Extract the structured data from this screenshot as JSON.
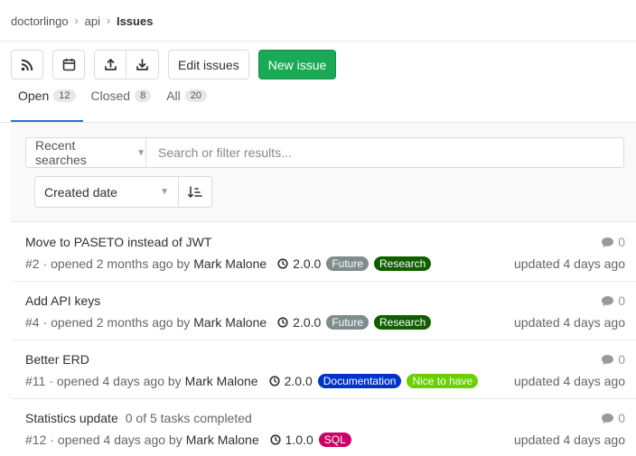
{
  "breadcrumb": {
    "group": "doctorlingo",
    "project": "api",
    "current": "Issues"
  },
  "toolbar": {
    "edit_label": "Edit issues",
    "new_label": "New issue"
  },
  "tabs": [
    {
      "label": "Open",
      "count": "12"
    },
    {
      "label": "Closed",
      "count": "8"
    },
    {
      "label": "All",
      "count": "20"
    }
  ],
  "filter": {
    "recent_label": "Recent searches",
    "search_placeholder": "Search or filter results...",
    "sort_label": "Created date"
  },
  "issues": [
    {
      "title": "Move to PASETO instead of JWT",
      "tasks": "",
      "ref": "#2",
      "opened": "· opened 2 months ago by",
      "author": "Mark Malone",
      "milestone": "2.0.0",
      "labels": [
        {
          "text": "Future",
          "color": "#7f8c8d"
        },
        {
          "text": "Research",
          "color": "#105e00"
        }
      ],
      "comments": "0",
      "updated": "updated 4 days ago"
    },
    {
      "title": "Add API keys",
      "tasks": "",
      "ref": "#4",
      "opened": "· opened 2 months ago by",
      "author": "Mark Malone",
      "milestone": "2.0.0",
      "labels": [
        {
          "text": "Future",
          "color": "#7f8c8d"
        },
        {
          "text": "Research",
          "color": "#105e00"
        }
      ],
      "comments": "0",
      "updated": "updated 4 days ago"
    },
    {
      "title": "Better ERD",
      "tasks": "",
      "ref": "#11",
      "opened": "· opened 4 days ago by",
      "author": "Mark Malone",
      "milestone": "2.0.0",
      "labels": [
        {
          "text": "Documentation",
          "color": "#0033cc"
        },
        {
          "text": "Nice to have",
          "color": "#69d100"
        }
      ],
      "comments": "0",
      "updated": "updated 4 days ago"
    },
    {
      "title": "Statistics update",
      "tasks": "0 of 5 tasks completed",
      "ref": "#12",
      "opened": "· opened 4 days ago by",
      "author": "Mark Malone",
      "milestone": "1.0.0",
      "labels": [
        {
          "text": "SQL",
          "color": "#cc0066"
        }
      ],
      "comments": "0",
      "updated": "updated 4 days ago"
    }
  ]
}
